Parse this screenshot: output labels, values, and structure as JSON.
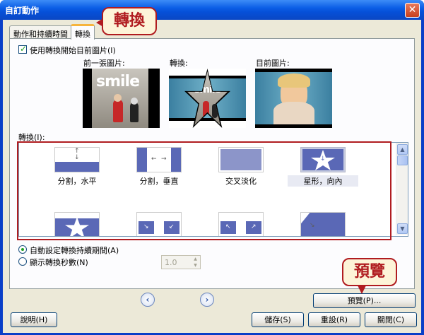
{
  "window": {
    "title": "自訂動作",
    "close_glyph": "✕"
  },
  "tabs": [
    {
      "label": "動作和持續時間"
    },
    {
      "label": "轉換"
    }
  ],
  "callouts": {
    "tab": "轉換",
    "preview": "預覽"
  },
  "use_transition_checkbox": {
    "label": "使用轉換開始目前圖片(I)",
    "checked": true
  },
  "previews": {
    "previous_label": "前一張圖片:",
    "transition_label": "轉換:",
    "current_label": "目前圖片:",
    "smile_text": "smile"
  },
  "transitions_label": "轉換(I):",
  "transitions": [
    {
      "label": "分割，水平",
      "selected": false
    },
    {
      "label": "分割，垂直",
      "selected": false
    },
    {
      "label": "交叉淡化",
      "selected": false
    },
    {
      "label": "星形，向內",
      "selected": true
    }
  ],
  "duration_options": {
    "auto_label": "自動設定轉換持續期間(A)",
    "auto_selected": true,
    "seconds_label": "顯示轉換秒數(N)",
    "seconds_value": "1.0"
  },
  "buttons": {
    "preview": "預覽(P)...",
    "help": "說明(H)",
    "save": "儲存(S)",
    "reset": "重設(R)",
    "close": "關閉(C)"
  },
  "icons": {
    "prev": "‹",
    "next": "›",
    "scroll_up": "▲",
    "scroll_down": "▼",
    "spin_up": "▲",
    "spin_down": "▼",
    "check": "✓"
  }
}
